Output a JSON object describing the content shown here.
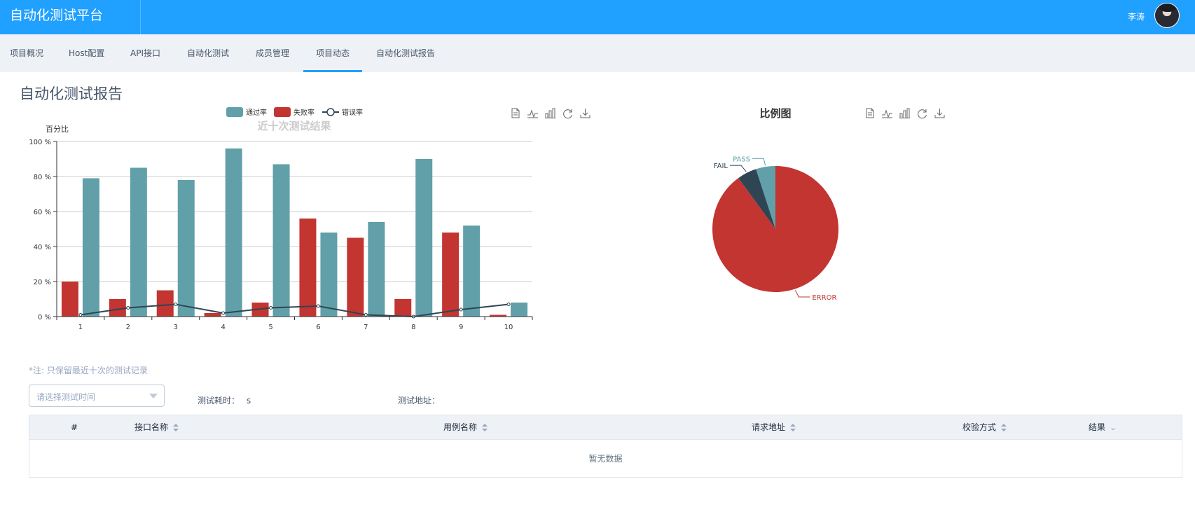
{
  "header": {
    "brand": "自动化测试平台",
    "user_name": "李涛"
  },
  "nav": {
    "items": [
      {
        "label": "项目概况"
      },
      {
        "label": "Host配置"
      },
      {
        "label": "API接口"
      },
      {
        "label": "自动化测试"
      },
      {
        "label": "成员管理"
      },
      {
        "label": "项目动态",
        "active": true
      },
      {
        "label": "自动化测试报告"
      }
    ]
  },
  "page_title": "自动化测试报告",
  "chart_data": [
    {
      "type": "bar",
      "title": "近十次测试结果",
      "ylabel": "百分比",
      "ylim": [
        0,
        100
      ],
      "yticks": [
        "0 %",
        "20 %",
        "40 %",
        "60 %",
        "80 %",
        "100 %"
      ],
      "categories": [
        "1",
        "2",
        "3",
        "4",
        "5",
        "6",
        "7",
        "8",
        "9",
        "10"
      ],
      "legend_position": "top",
      "grid": true,
      "series": [
        {
          "name": "失败率",
          "kind": "bar",
          "color": "#c23531",
          "values": [
            20,
            10,
            15,
            2,
            8,
            56,
            45,
            10,
            48,
            1
          ]
        },
        {
          "name": "通过率",
          "kind": "bar",
          "color": "#61a0a8",
          "values": [
            79,
            85,
            78,
            96,
            87,
            48,
            54,
            90,
            52,
            8
          ]
        },
        {
          "name": "错误率",
          "kind": "line",
          "color": "#2f4554",
          "values": [
            1,
            5,
            7,
            2,
            5,
            6,
            1,
            0,
            4,
            7
          ]
        }
      ],
      "legend_order": [
        "通过率",
        "失败率",
        "错误率"
      ]
    },
    {
      "type": "pie",
      "title": "比例图",
      "slices": [
        {
          "label": "ERROR",
          "value": 90,
          "color": "#c23531"
        },
        {
          "label": "FAIL",
          "value": 5,
          "color": "#2f4554"
        },
        {
          "label": "PASS",
          "value": 5,
          "color": "#61a0a8"
        }
      ]
    }
  ],
  "toolbox_icons": [
    "data-view-icon",
    "line-chart-icon",
    "bar-chart-icon",
    "restore-icon",
    "download-icon"
  ],
  "note": "*注: 只保留最近十次的测试记录",
  "filter": {
    "select_placeholder": "请选择测试时间",
    "duration_label": "测试耗时：",
    "duration_value": "s",
    "address_label": "测试地址："
  },
  "table": {
    "columns": [
      {
        "label": "#",
        "sortable": false
      },
      {
        "label": "接口名称",
        "sortable": true
      },
      {
        "label": "用例名称",
        "sortable": true
      },
      {
        "label": "请求地址",
        "sortable": true
      },
      {
        "label": "校验方式",
        "sortable": true
      },
      {
        "label": "结果",
        "filter": true
      }
    ],
    "empty_text": "暂无数据"
  },
  "colors": {
    "primary": "#20a0ff",
    "nav_bg": "#eef1f6",
    "pass": "#61a0a8",
    "fail": "#c23531",
    "error_line": "#2f4554"
  }
}
